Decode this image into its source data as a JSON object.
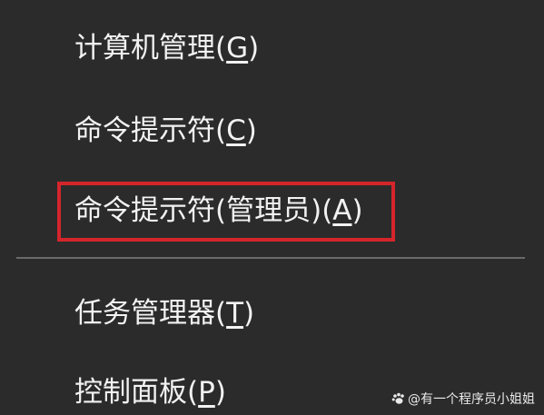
{
  "menu": {
    "items": [
      {
        "label": "计算机管理(",
        "accel": "G",
        "suffix": ")"
      },
      {
        "label": "命令提示符(",
        "accel": "C",
        "suffix": ")"
      },
      {
        "label": "命令提示符(管理员)(",
        "accel": "A",
        "suffix": ")"
      },
      {
        "label": "任务管理器(",
        "accel": "T",
        "suffix": ")"
      },
      {
        "label": "控制面板(",
        "accel": "P",
        "suffix": ")"
      }
    ],
    "highlight_color": "#d4252c",
    "background_color": "#2b2b2b"
  },
  "watermark": {
    "text": "@有一个程序员小姐姐",
    "icon": "paw-icon"
  }
}
